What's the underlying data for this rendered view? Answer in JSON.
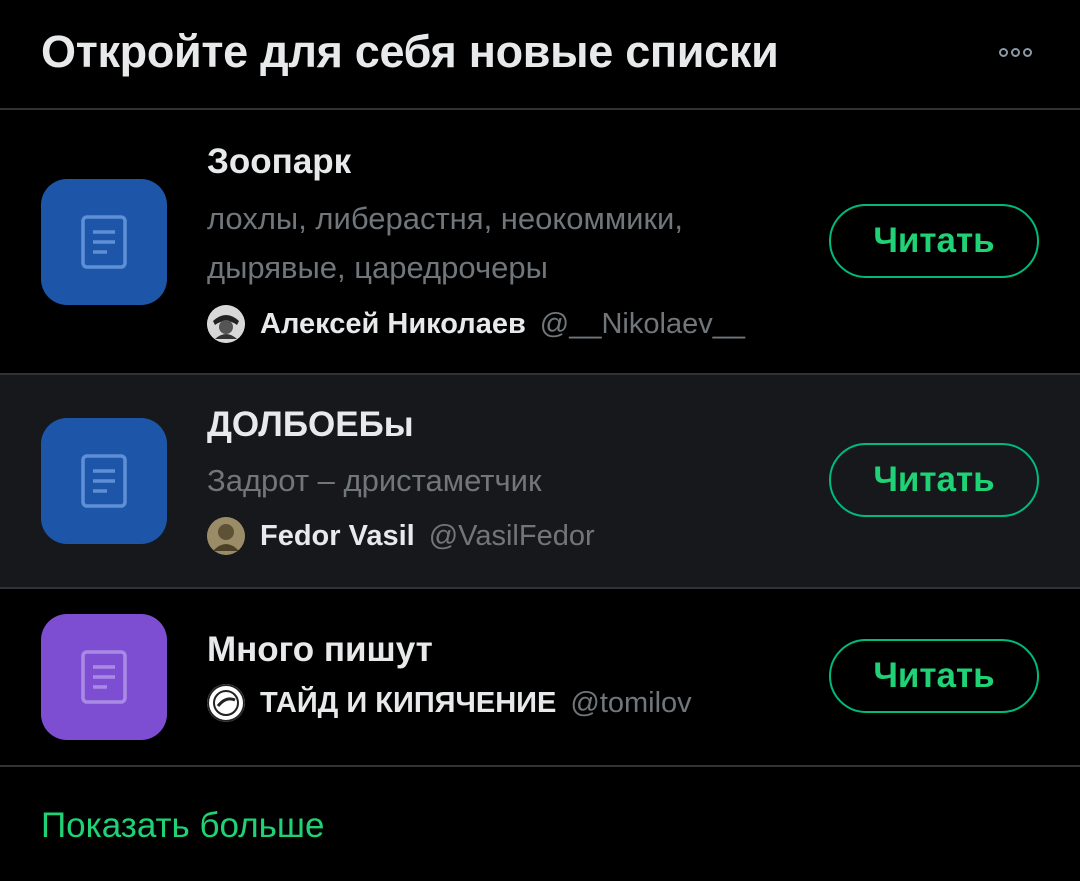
{
  "header": {
    "title": "Откройте для себя новые списки",
    "more_icon": "more-horizontal-icon"
  },
  "lists": [
    {
      "name": "Зоопарк",
      "description_lines": [
        "лохлы, либерастня, неокоммики,",
        "дырявые, царедрочеры"
      ],
      "owner_name": "Алексей Николаев",
      "owner_handle": "@__Nikolaev__",
      "button_label": "Читать",
      "icon_color": "#1d56a8"
    },
    {
      "name": "ДОЛБОЕБы",
      "description_lines": [
        "Задрот – дристаметчик"
      ],
      "owner_name": "Fedor Vasil",
      "owner_handle": "@VasilFedor",
      "button_label": "Читать",
      "icon_color": "#1d56a8"
    },
    {
      "name": "Много пишут",
      "description_lines": [],
      "owner_name": "ТАЙД И КИПЯЧЕНИЕ",
      "owner_handle": "@tomilov",
      "button_label": "Читать",
      "icon_color": "#7d4ed1"
    }
  ],
  "show_more_label": "Показать больше",
  "colors": {
    "background": "#000000",
    "accent_green": "#1ed275",
    "divider": "#2f3336",
    "secondary_text": "#71767b",
    "highlight_row": "#16181c"
  }
}
